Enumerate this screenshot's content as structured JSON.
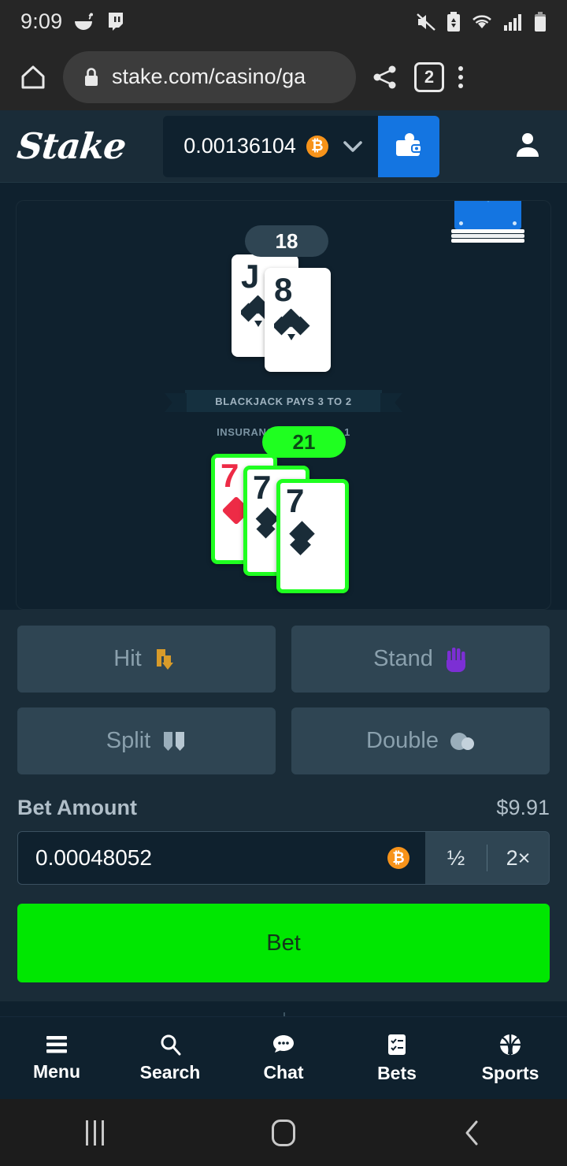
{
  "statusbar": {
    "time": "9:09",
    "left_icons": [
      "food-app-icon",
      "twitch-icon"
    ],
    "right_icons": [
      "mute-icon",
      "battery-saver-icon",
      "wifi-icon",
      "signal-icon",
      "battery-icon"
    ]
  },
  "browser": {
    "url": "stake.com/casino/ga",
    "tab_count": "2",
    "home_icon": "home-icon",
    "lock_icon": "lock-icon",
    "share_icon": "share-icon",
    "menu_icon": "overflow-menu-icon"
  },
  "header": {
    "logo": "Stake",
    "balance": "0.00136104",
    "currency_icon": "bitcoin-icon",
    "chevron_icon": "chevron-down-icon",
    "wallet_icon": "wallet-icon",
    "profile_icon": "profile-icon"
  },
  "game": {
    "dealer": {
      "score": "18",
      "cards": [
        {
          "rank": "J",
          "suit": "clubs",
          "color": "#1a2c38"
        },
        {
          "rank": "8",
          "suit": "clubs",
          "color": "#1a2c38"
        }
      ]
    },
    "player": {
      "score": "21",
      "highlight_color": "#1fff20",
      "cards": [
        {
          "rank": "7",
          "suit": "diamonds",
          "color": "#ed2b46"
        },
        {
          "rank": "7",
          "suit": "spades",
          "color": "#1a2c38"
        },
        {
          "rank": "7",
          "suit": "spades",
          "color": "#1a2c38"
        }
      ]
    },
    "banner_main": "BLACKJACK PAYS 3 TO 2",
    "banner_sub": "INSURANCE PAYS 2 TO 1",
    "deck_icon": "card-deck-icon"
  },
  "actions": [
    {
      "label": "Hit",
      "icon": "card-down-arrow-icon",
      "glyph": "↓",
      "disabled": true
    },
    {
      "label": "Stand",
      "icon": "raised-hand-icon",
      "glyph": "✋",
      "disabled": true
    },
    {
      "label": "Split",
      "icon": "split-cards-icon",
      "glyph": "❖",
      "disabled": true
    },
    {
      "label": "Double",
      "icon": "chips-icon",
      "glyph": "●",
      "disabled": true
    }
  ],
  "bet": {
    "label": "Bet Amount",
    "fiat_value": "$9.91",
    "amount": "0.00048052",
    "currency_icon": "bitcoin-icon",
    "half_label": "½",
    "double_label": "2×",
    "submit_label": "Bet",
    "submit_color": "#00e701"
  },
  "appnav": [
    {
      "label": "Menu",
      "icon": "hamburger-icon"
    },
    {
      "label": "Search",
      "icon": "search-icon"
    },
    {
      "label": "Chat",
      "icon": "chat-bubble-icon"
    },
    {
      "label": "Bets",
      "icon": "checklist-icon"
    },
    {
      "label": "Sports",
      "icon": "basketball-icon"
    }
  ],
  "androidnav": [
    {
      "icon": "recents-icon"
    },
    {
      "icon": "home-icon"
    },
    {
      "icon": "back-icon"
    }
  ]
}
